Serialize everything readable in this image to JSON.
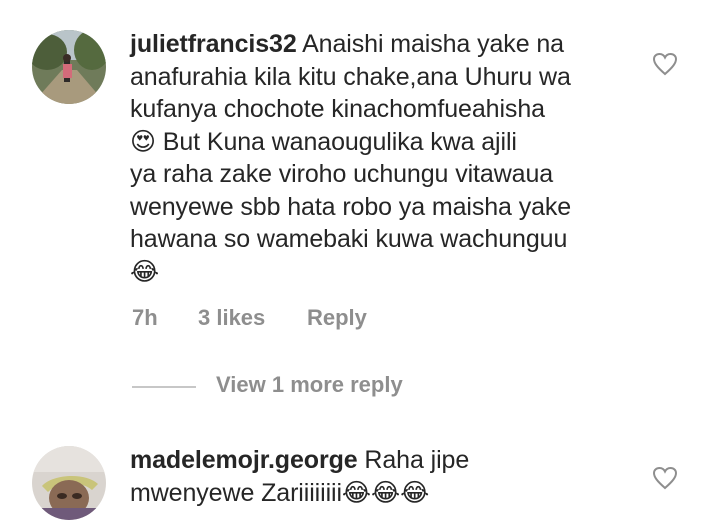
{
  "comments": [
    {
      "username": "julietfrancis32",
      "lines": [
        " Anaishi maisha yake na",
        "anafurahia kila kitu chake,ana Uhuru wa",
        "kufanya chochote kinachomfueahisha",
        "😍 But Kuna wanaougulika kwa ajili",
        "ya raha zake viroho uchungu vitawaua",
        "wenyewe sbb hata robo ya maisha yake",
        "hawana so wamebaki kuwa wachunguu",
        "😂"
      ],
      "time": "7h",
      "likes": "3 likes",
      "reply": "Reply",
      "like_icon": "heart-outline-icon"
    },
    {
      "username": "madelemojr.george",
      "lines": [
        " Raha jipe",
        "mwenyewe Zariiiiiiii😂😂😂"
      ],
      "like_icon": "heart-outline-icon"
    }
  ],
  "view_more": "View 1 more reply",
  "colors": {
    "text": "#262626",
    "secondary": "#8e8e8e",
    "divider": "#c7c7c7"
  }
}
